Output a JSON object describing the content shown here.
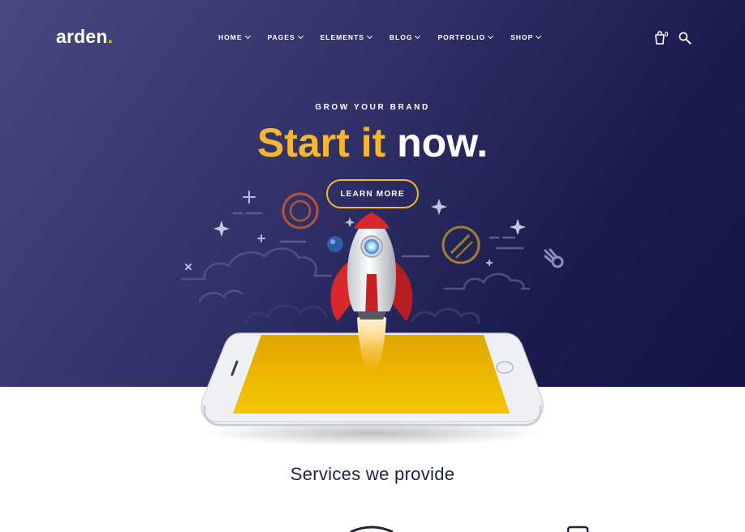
{
  "brand": {
    "name": "arden",
    "dot": "."
  },
  "nav": [
    {
      "label": "HOME"
    },
    {
      "label": "PAGES"
    },
    {
      "label": "ELEMENTS"
    },
    {
      "label": "BLOG"
    },
    {
      "label": "PORTFOLIO"
    },
    {
      "label": "SHOP"
    }
  ],
  "header": {
    "cart_count": "0"
  },
  "hero": {
    "kicker": "GROW YOUR BRAND",
    "headline_highlight": "Start it",
    "headline_rest": " now.",
    "cta_label": "LEARN MORE"
  },
  "services": {
    "title": "Services we provide"
  },
  "colors": {
    "accent": "#f5b731",
    "hero_bg": "#2e3066",
    "rocket_red": "#d8282c",
    "screen_yellow": "#f7c200",
    "text_dark": "#1f2240"
  },
  "icons": [
    "cart-icon",
    "search-icon",
    "chevron-down-icon",
    "rocket-illustration",
    "smartphone-illustration",
    "planet-icon",
    "sparkle-icon",
    "comet-icon"
  ]
}
